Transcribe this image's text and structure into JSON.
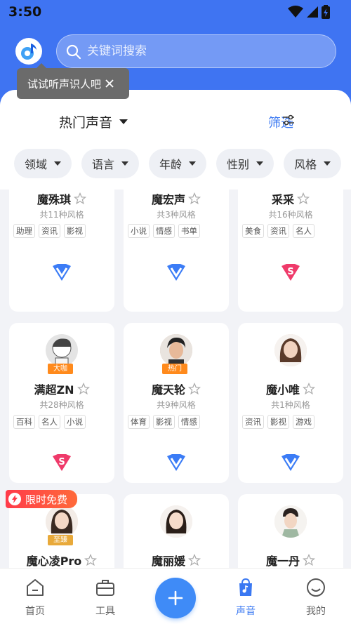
{
  "status_bar": {
    "time": "3:50"
  },
  "search": {
    "placeholder": "关键词搜索"
  },
  "tooltip": {
    "text": "试试听声识人吧"
  },
  "header": {
    "title": "热门声音",
    "filter_label": "筛选"
  },
  "filter_chips": [
    "领域",
    "语言",
    "年龄",
    "性别",
    "风格"
  ],
  "free_badge": "限时免费",
  "cards": [
    {
      "name": "魔殊琪",
      "styles": "共11种风格",
      "tags": [
        "助理",
        "资讯",
        "影视"
      ],
      "badge": "v"
    },
    {
      "name": "魔宏声",
      "styles": "共3种风格",
      "tags": [
        "小说",
        "情感",
        "书单"
      ],
      "badge": "v"
    },
    {
      "name": "采采",
      "styles": "共16种风格",
      "tags": [
        "美食",
        "资讯",
        "名人"
      ],
      "badge": "s",
      "label": "大咖"
    },
    {
      "name": "满超ZN",
      "styles": "共28种风格",
      "tags": [
        "百科",
        "名人",
        "小说"
      ],
      "badge": "s",
      "label": "大咖"
    },
    {
      "name": "魔天轮",
      "styles": "共9种风格",
      "tags": [
        "体育",
        "影视",
        "情感"
      ],
      "badge": "v",
      "label": "热门"
    },
    {
      "name": "魔小唯",
      "styles": "共1种风格",
      "tags": [
        "资讯",
        "影视",
        "游戏"
      ],
      "badge": "v"
    },
    {
      "name": "魔心凌Pro",
      "label": "至臻"
    },
    {
      "name": "魔丽媛"
    },
    {
      "name": "魔一丹"
    }
  ],
  "nav": [
    {
      "label": "首页",
      "icon": "home-icon"
    },
    {
      "label": "工具",
      "icon": "toolbox-icon"
    },
    {
      "label": "声音",
      "icon": "voice-bag-icon",
      "active": true
    },
    {
      "label": "我的",
      "icon": "smile-icon"
    }
  ],
  "colors": {
    "primary": "#3f74f2",
    "accent": "#3a78f2",
    "free": "#ff3b4a",
    "hot": "#ff8a1c"
  }
}
